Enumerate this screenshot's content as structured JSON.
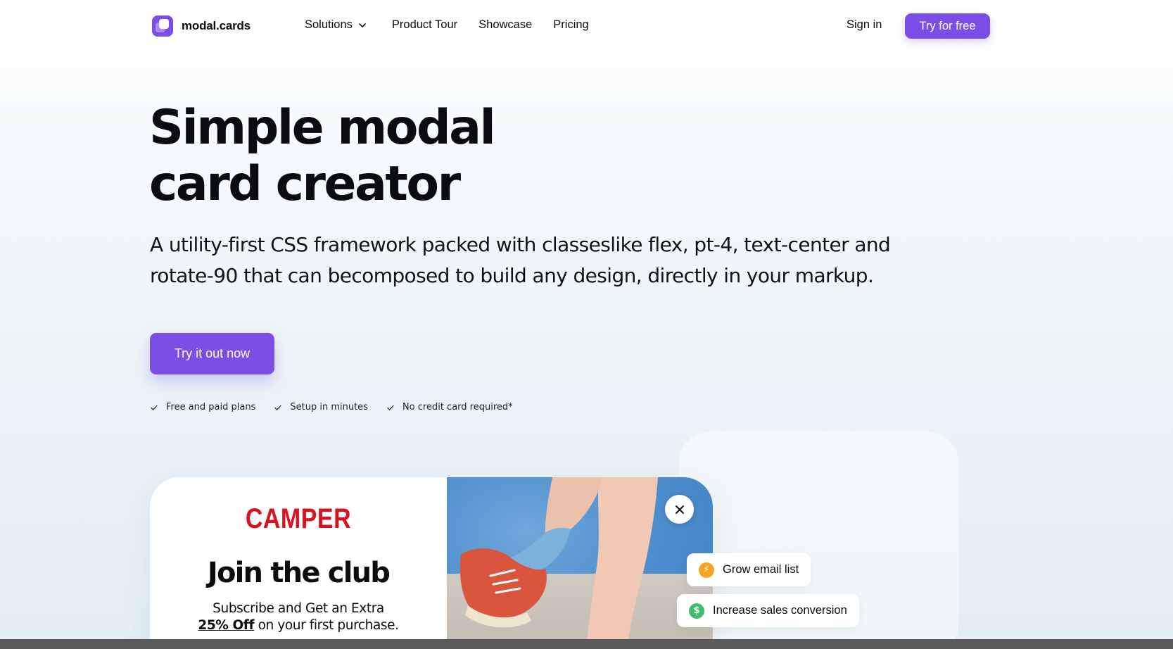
{
  "brand": {
    "name": "modal.cards"
  },
  "nav": {
    "items": [
      {
        "label": "Solutions",
        "has_dropdown": true
      },
      {
        "label": "Product Tour"
      },
      {
        "label": "Showcase"
      },
      {
        "label": "Pricing"
      }
    ],
    "sign_in": "Sign in",
    "cta": "Try for free"
  },
  "hero": {
    "title_line1": "Simple modal",
    "title_line2": "card creator",
    "subtitle_line1": "A utility-first CSS framework packed with classeslike flex, pt-4, text-center and",
    "subtitle_line2": "rotate-90 that can becomposed to build any design, directly in your markup.",
    "cta": "Try it out now",
    "checks": [
      "Free and paid plans",
      "Setup in minutes",
      "No credit card required*"
    ]
  },
  "showcase": {
    "modal": {
      "brand": "CAMPER",
      "title": "Join the club",
      "line1": "Subscribe and Get an Extra",
      "offer_bold": "25% Off",
      "offer_rest": " on your first purchase."
    },
    "features": [
      {
        "label": "Grow email list",
        "icon": "lightning-icon",
        "color": "#f5a524"
      },
      {
        "label": "Increase sales conversion",
        "icon": "dollar-icon",
        "color": "#3fbf6b"
      }
    ]
  },
  "colors": {
    "accent": "#7b4fe6",
    "brand_red": "#d8131f"
  }
}
